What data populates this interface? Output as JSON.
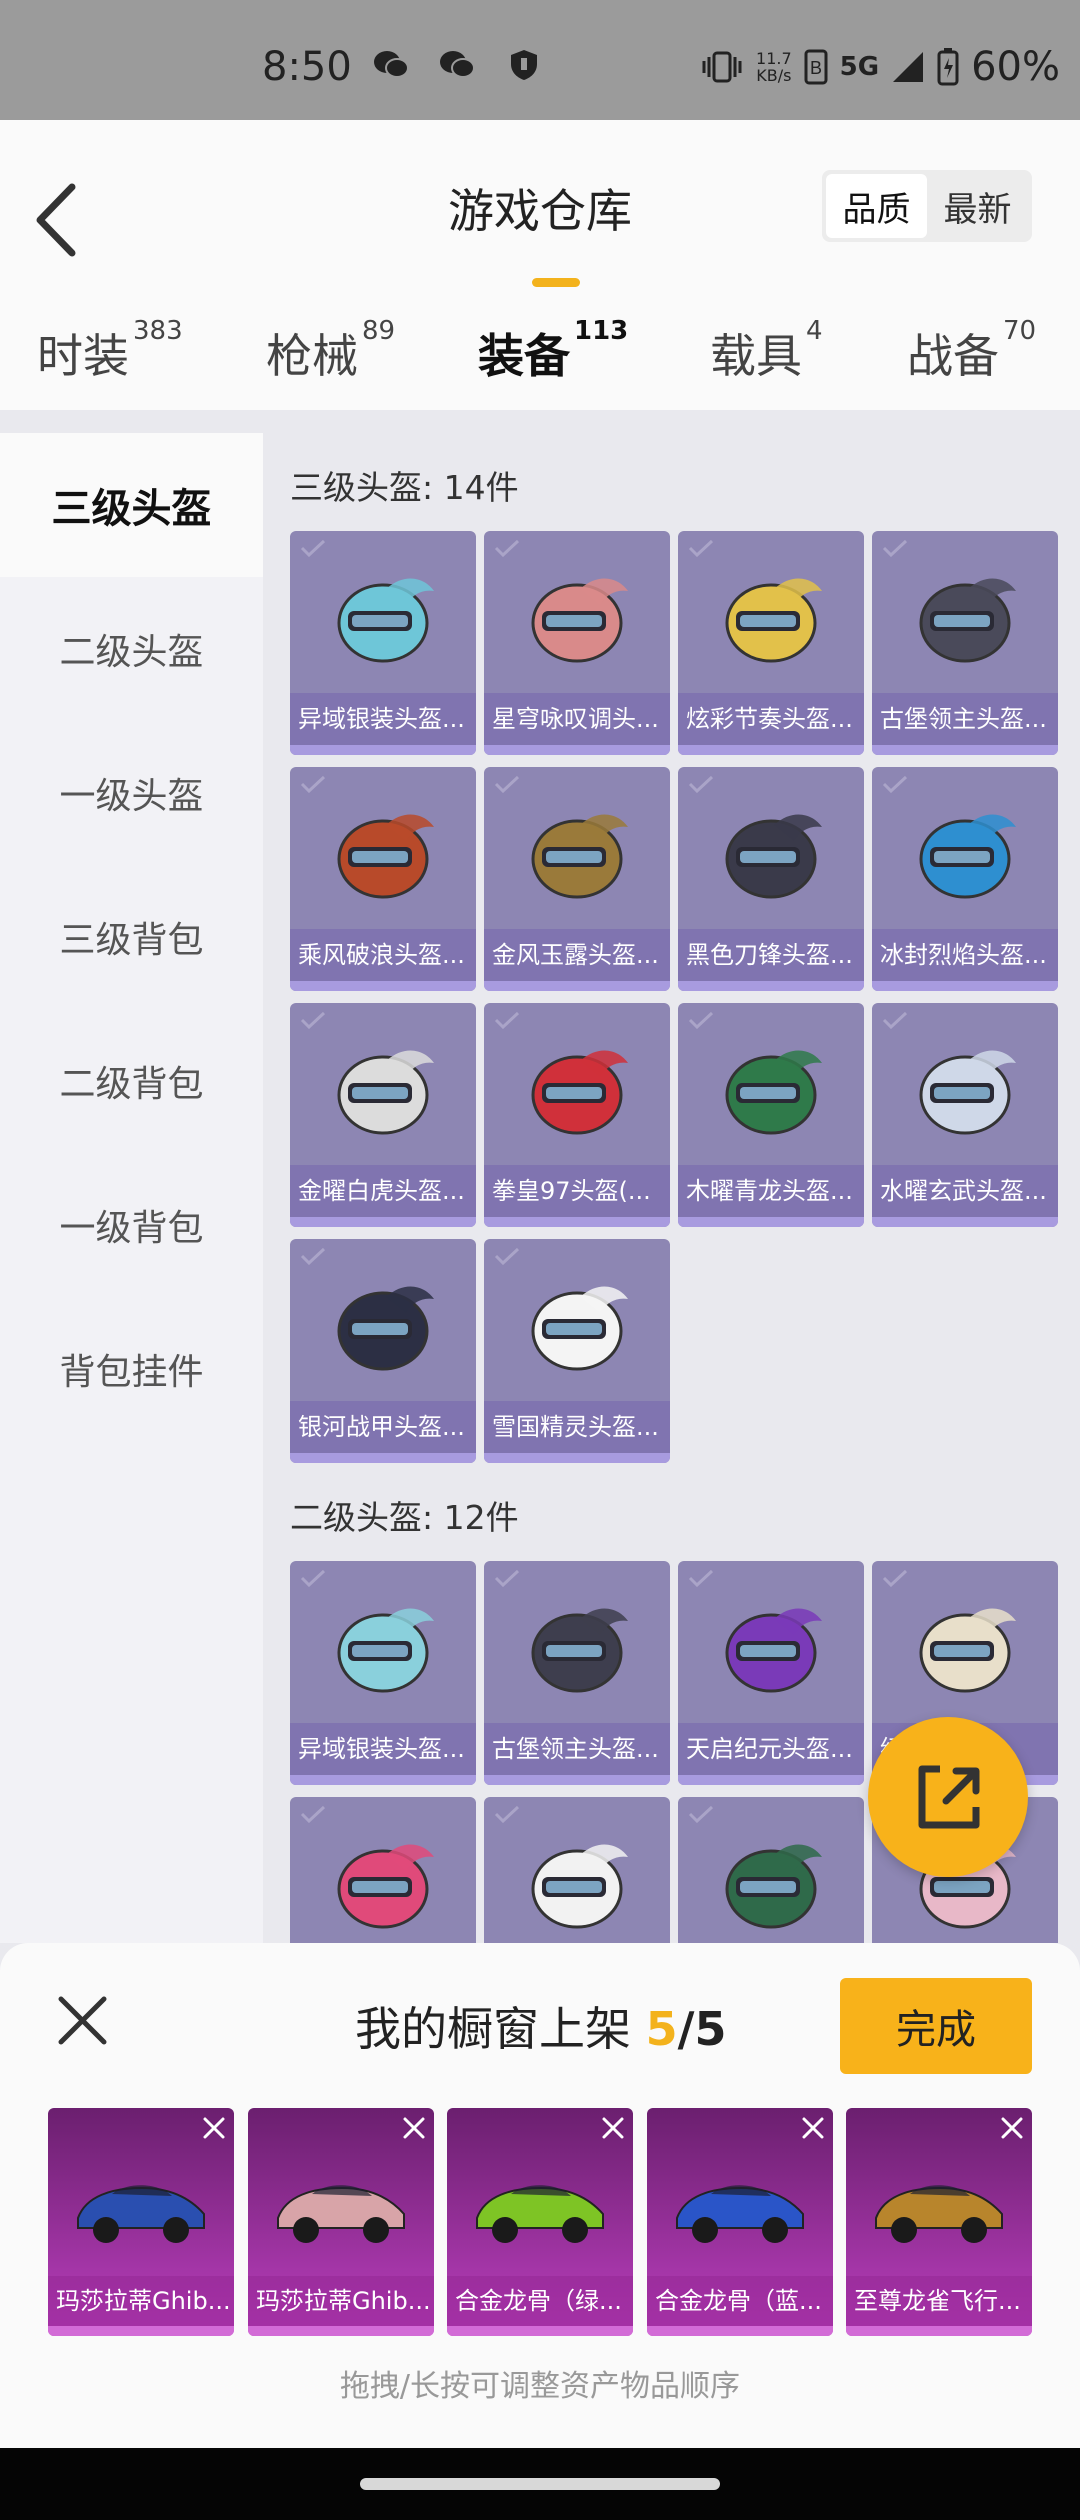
{
  "status_bar": {
    "time": "8:50",
    "net_speed": "11.7",
    "net_unit": "KB/s",
    "net_type": "5G",
    "battery": "60%"
  },
  "header": {
    "title": "游戏仓库",
    "sort_options": [
      {
        "label": "品质"
      },
      {
        "label": "最新"
      }
    ]
  },
  "tabs": [
    {
      "label": "时装",
      "count": "383"
    },
    {
      "label": "枪械",
      "count": "89"
    },
    {
      "label": "装备",
      "count": "113"
    },
    {
      "label": "载具",
      "count": "4"
    },
    {
      "label": "战备",
      "count": "70"
    }
  ],
  "sidebar": [
    {
      "label": "三级头盔"
    },
    {
      "label": "二级头盔"
    },
    {
      "label": "一级头盔"
    },
    {
      "label": "三级背包"
    },
    {
      "label": "二级背包"
    },
    {
      "label": "一级背包"
    },
    {
      "label": "背包挂件"
    }
  ],
  "sections": [
    {
      "title": "三级头盔: 14件",
      "items": [
        {
          "name": "异域银装头盔...",
          "color": "#6ec6d8"
        },
        {
          "name": "星穹咏叹调头...",
          "color": "#d98a8a"
        },
        {
          "name": "炫彩节奏头盔...",
          "color": "#e2c14a"
        },
        {
          "name": "古堡领主头盔...",
          "color": "#4a4a5a"
        },
        {
          "name": "乘风破浪头盔...",
          "color": "#b84a2a"
        },
        {
          "name": "金风玉露头盔...",
          "color": "#9a7a3a"
        },
        {
          "name": "黑色刀锋头盔...",
          "color": "#3a3a4a"
        },
        {
          "name": "冰封烈焰头盔...",
          "color": "#2e8fd0"
        },
        {
          "name": "金曜白虎头盔...",
          "color": "#dcdcdc"
        },
        {
          "name": "拳皇97头盔(...",
          "color": "#d0303a"
        },
        {
          "name": "木曜青龙头盔...",
          "color": "#2f7a4a"
        },
        {
          "name": "水曜玄武头盔...",
          "color": "#cfd8e8"
        },
        {
          "name": "银河战甲头盔...",
          "color": "#2c2f44"
        },
        {
          "name": "雪国精灵头盔...",
          "color": "#f4f4f4"
        }
      ]
    },
    {
      "title": "二级头盔: 12件",
      "items": [
        {
          "name": "异域银装头盔...",
          "color": "#8ad0dc"
        },
        {
          "name": "古堡领主头盔...",
          "color": "#3e3e4e"
        },
        {
          "name": "天启纪元头盔...",
          "color": "#7a3ab8"
        },
        {
          "name": "级)",
          "color": "#e8dfca"
        },
        {
          "name": "",
          "color": "#e04a7a"
        },
        {
          "name": "",
          "color": "#f2f2f2"
        },
        {
          "name": "",
          "color": "#2f6a4a"
        },
        {
          "name": "",
          "color": "#e8b8c8"
        }
      ]
    }
  ],
  "showcase": {
    "title": "我的橱窗上架",
    "current": "5",
    "total": "/5",
    "done_label": "完成",
    "hint": "拖拽/长按可调整资产物品顺序",
    "items": [
      {
        "name": "玛莎拉蒂Ghib...",
        "color": "#2a4fb0"
      },
      {
        "name": "玛莎拉蒂Ghib...",
        "color": "#d8a4a8"
      },
      {
        "name": "合金龙骨（绿...",
        "color": "#7ec425"
      },
      {
        "name": "合金龙骨（蓝...",
        "color": "#2a55c8"
      },
      {
        "name": "至尊龙雀飞行...",
        "color": "#b8852c"
      }
    ]
  }
}
